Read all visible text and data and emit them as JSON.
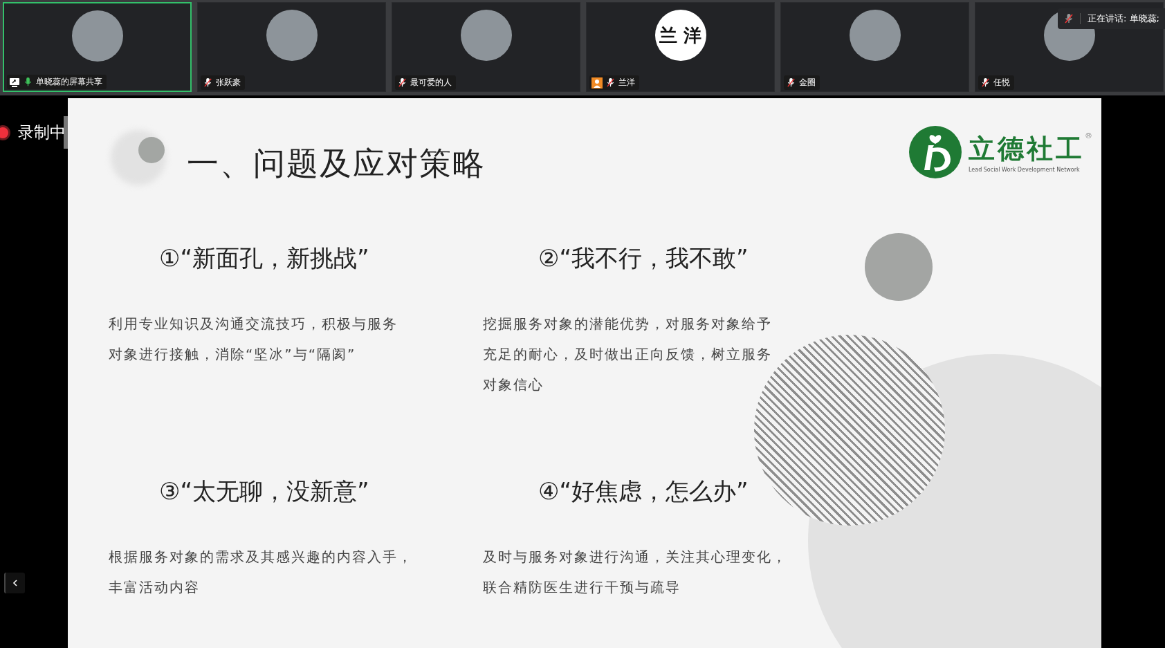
{
  "participants": [
    {
      "name": "单晓蕊的屏幕共享",
      "muted": false,
      "selected": true,
      "badge": {
        "kind": "share"
      },
      "avatar": {
        "kind": "photo"
      }
    },
    {
      "name": "张跃豪",
      "muted": true,
      "selected": false,
      "avatar": {
        "kind": "photo"
      }
    },
    {
      "name": "最可爱的人",
      "muted": true,
      "selected": false,
      "avatar": {
        "kind": "photo"
      }
    },
    {
      "name": "兰洋",
      "muted": true,
      "selected": false,
      "badge": {
        "kind": "person"
      },
      "avatar": {
        "kind": "text",
        "text": "兰 洋"
      }
    },
    {
      "name": "金圈",
      "muted": true,
      "selected": false,
      "avatar": {
        "kind": "photo"
      }
    },
    {
      "name": "任悦",
      "muted": true,
      "selected": false,
      "avatar": {
        "kind": "photo"
      }
    }
  ],
  "speaking_notice": "正在讲话: 单晓蕊;",
  "recording": {
    "label": "录制中"
  },
  "slide": {
    "title": "一、问题及应对策略",
    "logo": {
      "name": "立德社工",
      "registered": "®",
      "tagline": "Lead Social Work Development Network"
    },
    "items": [
      {
        "heading": "①“新面孔，新挑战”",
        "lines": [
          "利用专业知识及沟通交流技巧，积极与服务",
          "对象进行接触，消除“坚冰”与“隔阂”"
        ]
      },
      {
        "heading": "②“我不行，我不敢”",
        "lines": [
          "挖掘服务对象的潜能优势，对服务对象给予",
          "充足的耐心，及时做出正向反馈，树立服务",
          "对象信心"
        ]
      },
      {
        "heading": "③“太无聊，没新意”",
        "lines": [
          "根据服务对象的需求及其感兴趣的内容入手，",
          "丰富活动内容"
        ]
      },
      {
        "heading": "④“好焦虑，怎么办”",
        "lines": [
          "及时与服务对象进行沟通，关注其心理变化，",
          "联合精防医生进行干预与疏导"
        ]
      }
    ]
  }
}
